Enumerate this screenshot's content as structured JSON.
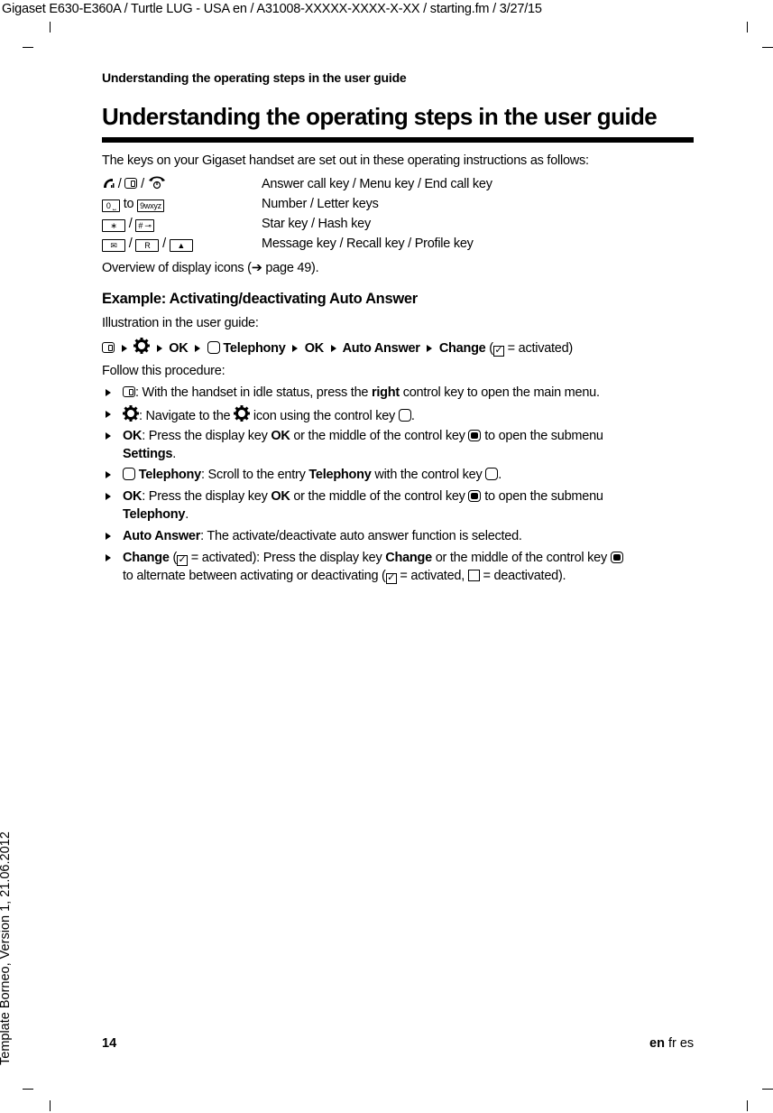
{
  "header": {
    "file_info": "Gigaset E630-E360A / Turtle LUG - USA en / A31008-XXXXX-XXXX-X-XX / starting.fm / 3/27/15",
    "running_head": "Understanding the operating steps in the user guide"
  },
  "side_text": "Template Borneo, Version 1, 21.06.2012",
  "title": "Understanding the operating steps in the user guide",
  "intro": "The keys on your Gigaset handset are set out in these operating instructions as follows:",
  "keys": [
    {
      "sep1": " / ",
      "sep2": " / ",
      "desc": "Answer call key / Menu key / End call key"
    },
    {
      "k1": "0 ⎵",
      "to": " to ",
      "k2": "9wxyz",
      "desc": "Number / Letter keys"
    },
    {
      "k1": "∗",
      "sep": " / ",
      "k2": "# ⊸",
      "desc": "Star key / Hash key"
    },
    {
      "k1": "✉",
      "k2": "R",
      "k3": "▲",
      "sep": " / ",
      "desc": "Message key / Recall key / Profile key"
    }
  ],
  "overview": {
    "prefix": "Overview of display icons (",
    "arrow": "➔",
    "page": " page 49)."
  },
  "example": {
    "heading": "Example: Activating/deactivating Auto Answer",
    "illustration_label": "Illustration in the user guide:",
    "path": {
      "ok": "OK",
      "telephony": "Telephony",
      "auto_answer": "Auto Answer",
      "change": "Change",
      "activated": "= activated)",
      "paren_open": " ("
    },
    "follow_label": "Follow this procedure:",
    "steps": {
      "s1_text1": ": With the handset in idle status, press the ",
      "s1_bold": "right",
      "s1_text2": " control key to open the main menu.",
      "s2_text1": ": Navigate to the ",
      "s2_text2": " icon using the control key ",
      "s2_end": ".",
      "s3_bold": "OK",
      "s3_text1": ": Press the display key ",
      "s3_bold2": "OK",
      "s3_text2": " or the middle of the control key ",
      "s3_text3": " to open the submenu",
      "s3_line2": "Settings",
      "s4_bold": "Telephony",
      "s4_text1": ": Scroll to the entry ",
      "s4_bold2": "Telephony",
      "s4_text2": " with the control key ",
      "s5_bold": "OK",
      "s5_text1": ": Press the display key ",
      "s5_bold2": "OK",
      "s5_text2": " or the middle of the control key ",
      "s5_text3": " to open the submenu",
      "s5_line2": "Telephony",
      "s6_bold": "Auto Answer",
      "s6_text": ": The activate/deactivate auto answer function is selected.",
      "s7_bold": "Change",
      "s7_text1": " (",
      "s7_text2": " = activated): Press the display key ",
      "s7_bold2": "Change",
      "s7_text3": " or the middle of the control key ",
      "s7_line2a": "to alternate between activating or deactivating (",
      "s7_line2b": " = activated, ",
      "s7_line2c": " = deactivated)."
    }
  },
  "footer": {
    "page_number": "14",
    "lang_active": "en",
    "lang_others": " fr es"
  }
}
